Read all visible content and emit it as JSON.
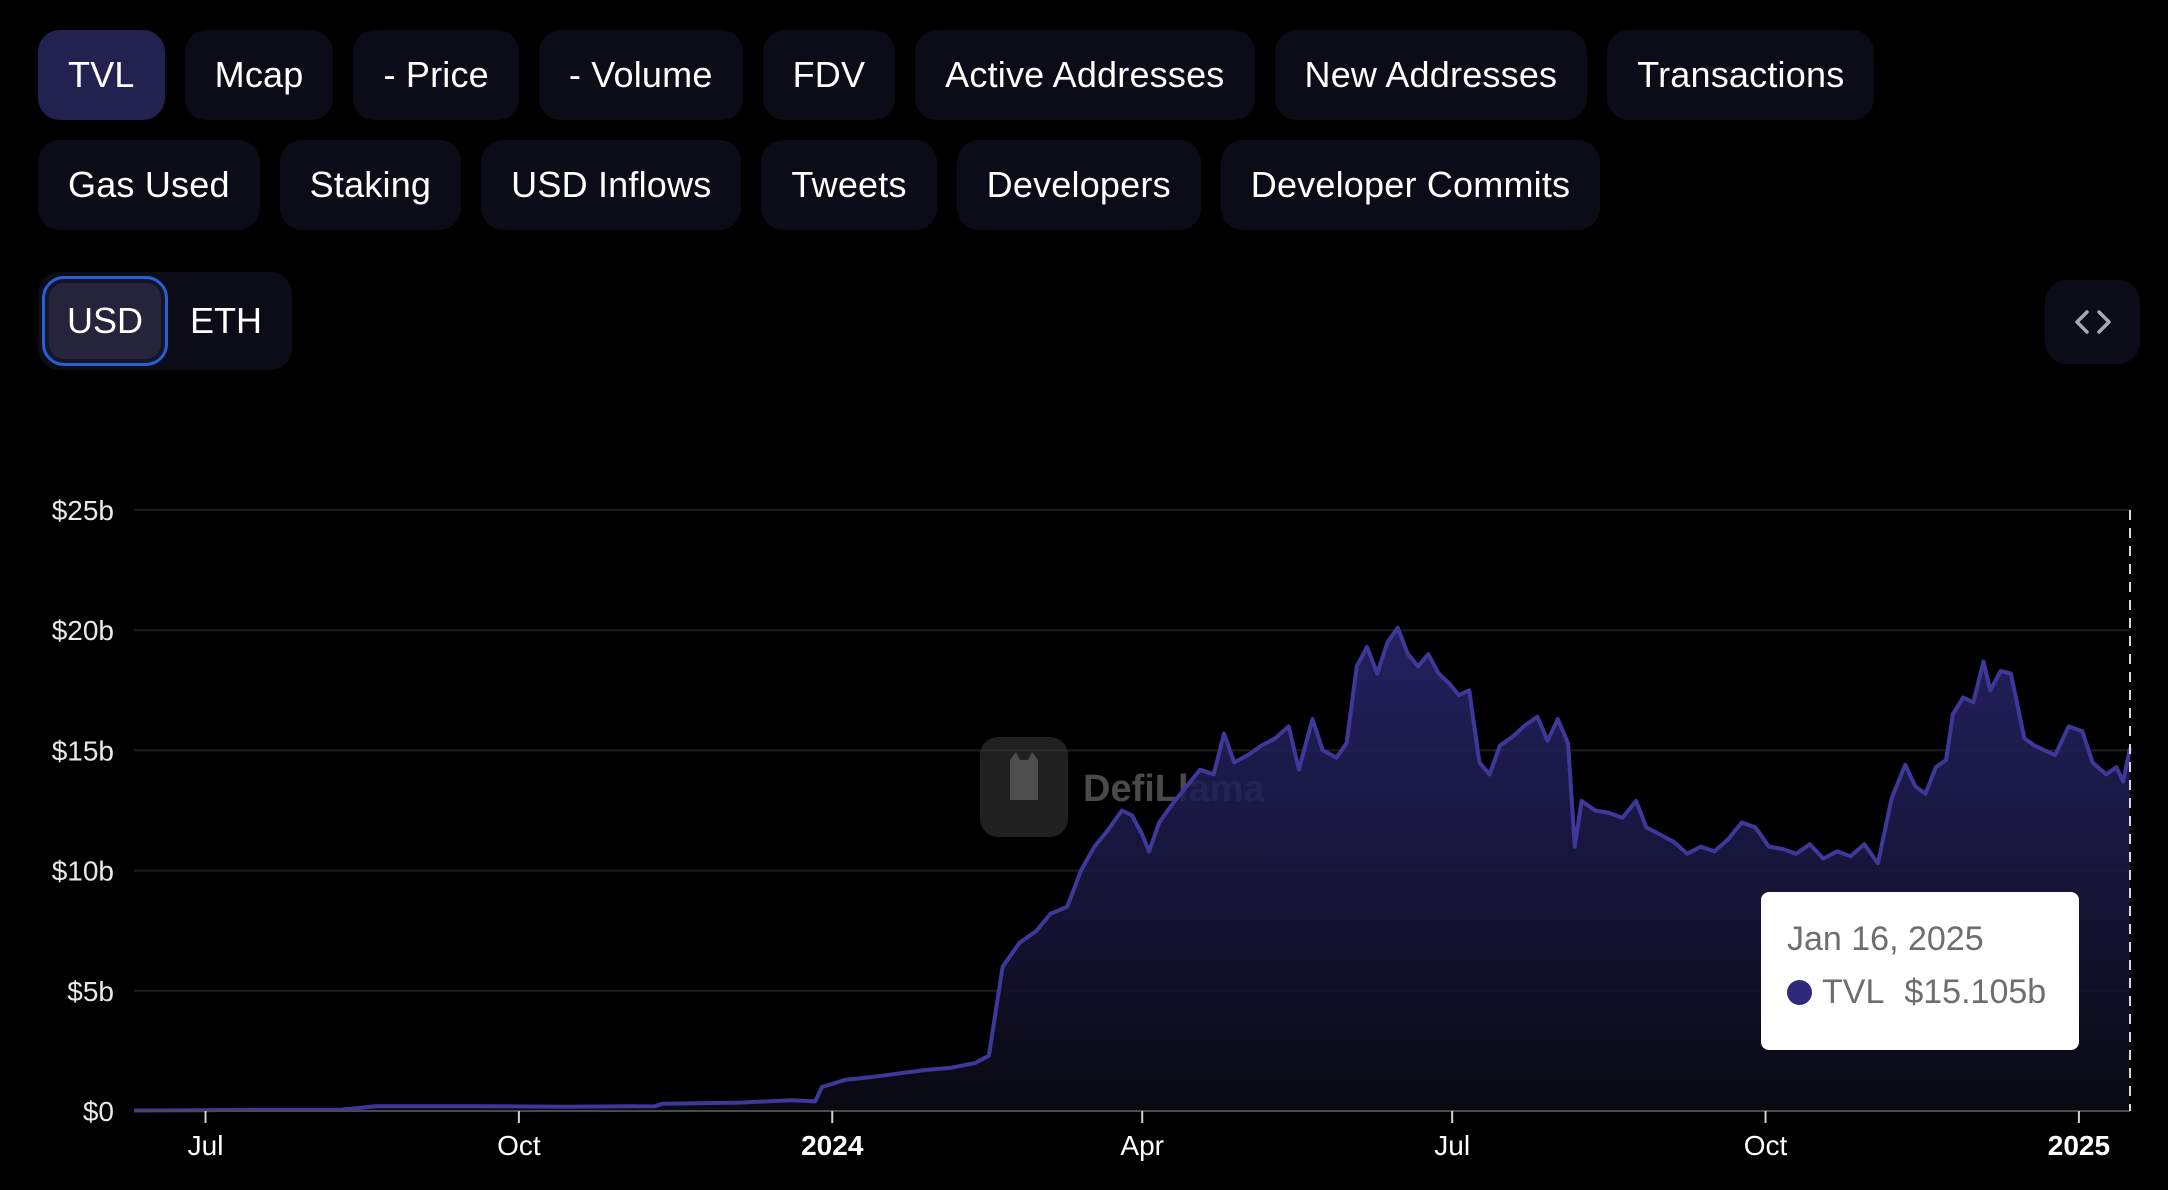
{
  "tabs": [
    {
      "label": "TVL",
      "active": true
    },
    {
      "label": "Mcap",
      "active": false
    },
    {
      "label": "- Price",
      "active": false
    },
    {
      "label": "- Volume",
      "active": false
    },
    {
      "label": "FDV",
      "active": false
    },
    {
      "label": "Active Addresses",
      "active": false
    },
    {
      "label": "New Addresses",
      "active": false
    },
    {
      "label": "Transactions",
      "active": false
    },
    {
      "label": "Gas Used",
      "active": false
    },
    {
      "label": "Staking",
      "active": false
    },
    {
      "label": "USD Inflows",
      "active": false
    },
    {
      "label": "Tweets",
      "active": false
    },
    {
      "label": "Developers",
      "active": false
    },
    {
      "label": "Developer Commits",
      "active": false
    }
  ],
  "denomination": {
    "options": [
      "USD",
      "ETH"
    ],
    "selected": "USD"
  },
  "embed_button": {
    "icon": "code-brackets-icon"
  },
  "watermark": {
    "text": "DefiLlama"
  },
  "colors": {
    "series": "#3d3899",
    "tooltip_dot": "#2f2a7c",
    "active_tab": "#232150",
    "toggle_border": "#2a5fd0"
  },
  "tooltip": {
    "date": "Jan 16, 2025",
    "series": "TVL",
    "value": "$15.105b"
  },
  "chart_data": {
    "type": "area",
    "title": "",
    "xlabel": "",
    "ylabel": "",
    "series_name": "TVL",
    "units": "USD billions",
    "ylim": [
      0,
      25
    ],
    "yticks": [
      0,
      5,
      10,
      15,
      20,
      25
    ],
    "ytick_labels": [
      "$0",
      "$5b",
      "$10b",
      "$15b",
      "$20b",
      "$25b"
    ],
    "xlim": [
      "2023-06-10",
      "2025-01-16"
    ],
    "xticks": [
      {
        "date": "2023-07-01",
        "label": "Jul",
        "bold": false
      },
      {
        "date": "2023-10-01",
        "label": "Oct",
        "bold": false
      },
      {
        "date": "2024-01-01",
        "label": "2024",
        "bold": true
      },
      {
        "date": "2024-04-01",
        "label": "Apr",
        "bold": false
      },
      {
        "date": "2024-07-01",
        "label": "Jul",
        "bold": false
      },
      {
        "date": "2024-10-01",
        "label": "Oct",
        "bold": false
      },
      {
        "date": "2025-01-01",
        "label": "2025",
        "bold": true
      }
    ],
    "grid": true,
    "hover_date": "2025-01-16",
    "points": [
      [
        "2023-06-10",
        0.02
      ],
      [
        "2023-07-01",
        0.03
      ],
      [
        "2023-07-12",
        0.05
      ],
      [
        "2023-08-10",
        0.06
      ],
      [
        "2023-08-20",
        0.2
      ],
      [
        "2023-09-20",
        0.2
      ],
      [
        "2023-10-15",
        0.18
      ],
      [
        "2023-11-10",
        0.2
      ],
      [
        "2023-11-12",
        0.3
      ],
      [
        "2023-12-05",
        0.35
      ],
      [
        "2023-12-20",
        0.45
      ],
      [
        "2023-12-27",
        0.4
      ],
      [
        "2023-12-29",
        1.0
      ],
      [
        "2024-01-05",
        1.3
      ],
      [
        "2024-01-12",
        1.4
      ],
      [
        "2024-01-20",
        1.55
      ],
      [
        "2024-01-28",
        1.7
      ],
      [
        "2024-02-05",
        1.8
      ],
      [
        "2024-02-12",
        2.0
      ],
      [
        "2024-02-16",
        2.3
      ],
      [
        "2024-02-20",
        6.0
      ],
      [
        "2024-02-25",
        7.0
      ],
      [
        "2024-03-01",
        7.5
      ],
      [
        "2024-03-05",
        8.2
      ],
      [
        "2024-03-10",
        8.5
      ],
      [
        "2024-03-14",
        10.0
      ],
      [
        "2024-03-18",
        11.0
      ],
      [
        "2024-03-22",
        11.7
      ],
      [
        "2024-03-26",
        12.5
      ],
      [
        "2024-03-29",
        12.3
      ],
      [
        "2024-04-01",
        11.5
      ],
      [
        "2024-04-03",
        10.8
      ],
      [
        "2024-04-06",
        12.0
      ],
      [
        "2024-04-10",
        12.8
      ],
      [
        "2024-04-14",
        13.5
      ],
      [
        "2024-04-18",
        14.2
      ],
      [
        "2024-04-22",
        14.0
      ],
      [
        "2024-04-25",
        15.7
      ],
      [
        "2024-04-28",
        14.5
      ],
      [
        "2024-05-02",
        14.8
      ],
      [
        "2024-05-06",
        15.2
      ],
      [
        "2024-05-10",
        15.5
      ],
      [
        "2024-05-14",
        16.0
      ],
      [
        "2024-05-17",
        14.2
      ],
      [
        "2024-05-21",
        16.3
      ],
      [
        "2024-05-24",
        15.0
      ],
      [
        "2024-05-28",
        14.7
      ],
      [
        "2024-05-31",
        15.3
      ],
      [
        "2024-06-03",
        18.5
      ],
      [
        "2024-06-06",
        19.3
      ],
      [
        "2024-06-09",
        18.2
      ],
      [
        "2024-06-12",
        19.5
      ],
      [
        "2024-06-15",
        20.1
      ],
      [
        "2024-06-18",
        19.0
      ],
      [
        "2024-06-21",
        18.5
      ],
      [
        "2024-06-24",
        19.0
      ],
      [
        "2024-06-27",
        18.2
      ],
      [
        "2024-06-30",
        17.8
      ],
      [
        "2024-07-03",
        17.3
      ],
      [
        "2024-07-06",
        17.5
      ],
      [
        "2024-07-09",
        14.5
      ],
      [
        "2024-07-12",
        14.0
      ],
      [
        "2024-07-15",
        15.2
      ],
      [
        "2024-07-19",
        15.6
      ],
      [
        "2024-07-22",
        16.0
      ],
      [
        "2024-07-26",
        16.4
      ],
      [
        "2024-07-29",
        15.4
      ],
      [
        "2024-08-01",
        16.3
      ],
      [
        "2024-08-04",
        15.3
      ],
      [
        "2024-08-06",
        11.0
      ],
      [
        "2024-08-08",
        12.9
      ],
      [
        "2024-08-12",
        12.5
      ],
      [
        "2024-08-16",
        12.4
      ],
      [
        "2024-08-20",
        12.2
      ],
      [
        "2024-08-24",
        12.9
      ],
      [
        "2024-08-27",
        11.8
      ],
      [
        "2024-08-31",
        11.5
      ],
      [
        "2024-09-04",
        11.2
      ],
      [
        "2024-09-08",
        10.7
      ],
      [
        "2024-09-12",
        11.0
      ],
      [
        "2024-09-16",
        10.8
      ],
      [
        "2024-09-20",
        11.3
      ],
      [
        "2024-09-24",
        12.0
      ],
      [
        "2024-09-28",
        11.8
      ],
      [
        "2024-10-02",
        11.0
      ],
      [
        "2024-10-06",
        10.9
      ],
      [
        "2024-10-10",
        10.7
      ],
      [
        "2024-10-14",
        11.1
      ],
      [
        "2024-10-18",
        10.5
      ],
      [
        "2024-10-22",
        10.8
      ],
      [
        "2024-10-26",
        10.6
      ],
      [
        "2024-10-30",
        11.1
      ],
      [
        "2024-11-03",
        10.3
      ],
      [
        "2024-11-07",
        13.0
      ],
      [
        "2024-11-11",
        14.4
      ],
      [
        "2024-11-14",
        13.5
      ],
      [
        "2024-11-17",
        13.2
      ],
      [
        "2024-11-20",
        14.3
      ],
      [
        "2024-11-23",
        14.6
      ],
      [
        "2024-11-25",
        16.5
      ],
      [
        "2024-11-28",
        17.2
      ],
      [
        "2024-12-01",
        17.0
      ],
      [
        "2024-12-04",
        18.7
      ],
      [
        "2024-12-06",
        17.5
      ],
      [
        "2024-12-09",
        18.3
      ],
      [
        "2024-12-12",
        18.2
      ],
      [
        "2024-12-16",
        15.5
      ],
      [
        "2024-12-19",
        15.2
      ],
      [
        "2024-12-22",
        15.0
      ],
      [
        "2024-12-25",
        14.8
      ],
      [
        "2024-12-29",
        16.0
      ],
      [
        "2025-01-02",
        15.8
      ],
      [
        "2025-01-05",
        14.5
      ],
      [
        "2025-01-09",
        14.0
      ],
      [
        "2025-01-12",
        14.3
      ],
      [
        "2025-01-14",
        13.7
      ],
      [
        "2025-01-16",
        15.105
      ]
    ]
  }
}
